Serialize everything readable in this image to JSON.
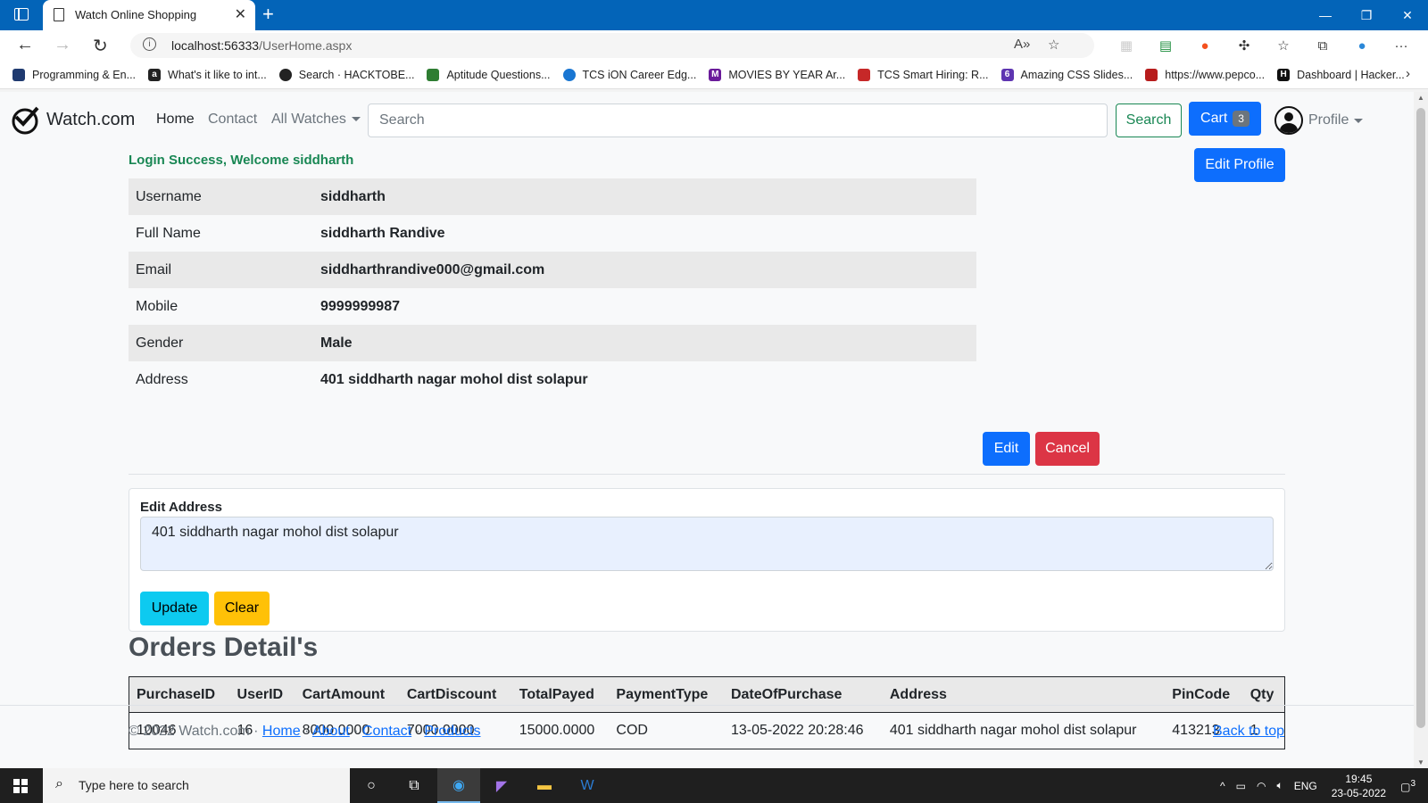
{
  "browser": {
    "tab_title": "Watch Online Shopping",
    "url_host": "localhost:56333",
    "url_path": "/UserHome.aspx"
  },
  "bookmarks": [
    {
      "label": "Programming & En...",
      "icon": "book-icon",
      "color": "#1f3a70"
    },
    {
      "label": "What's it like to int...",
      "icon": "amazon-icon",
      "color": "#222222"
    },
    {
      "label": "Search · HACKTOBE...",
      "icon": "github-icon",
      "color": "#222222"
    },
    {
      "label": "Aptitude Questions...",
      "icon": "leaf-icon",
      "color": "#2e7d32"
    },
    {
      "label": "TCS iON Career Edg...",
      "icon": "power-icon",
      "color": "#1976d2"
    },
    {
      "label": "MOVIES BY YEAR Ar...",
      "icon": "m-icon",
      "color": "#6a1b9a"
    },
    {
      "label": "TCS Smart Hiring: R...",
      "icon": "tcs-icon",
      "color": "#c62828"
    },
    {
      "label": "Amazing CSS Slides...",
      "icon": "six-icon",
      "color": "#5e35b1"
    },
    {
      "label": "https://www.pepco...",
      "icon": "cube-icon",
      "color": "#b71c1c"
    },
    {
      "label": "Dashboard | Hacker...",
      "icon": "hackerrank-icon",
      "color": "#111111"
    }
  ],
  "site": {
    "brand": "Watch.com",
    "nav": {
      "home": "Home",
      "contact": "Contact",
      "all_watches": "All Watches"
    },
    "search_placeholder": "Search",
    "search_button": "Search",
    "cart_label": "Cart",
    "cart_count": "3",
    "profile_label": "Profile"
  },
  "welcome": "Login Success, Welcome siddharth",
  "edit_profile_label": "Edit Profile",
  "details": [
    {
      "key": "Username",
      "value": "siddharth"
    },
    {
      "key": "Full Name",
      "value": "siddharth Randive"
    },
    {
      "key": "Email",
      "value": "siddharthrandive000@gmail.com"
    },
    {
      "key": "Mobile",
      "value": "9999999987"
    },
    {
      "key": "Gender",
      "value": "Male"
    },
    {
      "key": "Address",
      "value": "401 siddharth nagar mohol dist solapur"
    }
  ],
  "edit_label": "Edit",
  "cancel_label": "Cancel",
  "edit_address": {
    "label": "Edit Address",
    "value": "401 siddharth nagar mohol dist solapur",
    "update_label": "Update",
    "clear_label": "Clear"
  },
  "orders": {
    "title": "Orders Detail's",
    "columns": [
      "PurchaseID",
      "UserID",
      "CartAmount",
      "CartDiscount",
      "TotalPayed",
      "PaymentType",
      "DateOfPurchase",
      "Address",
      "PinCode",
      "Qty"
    ],
    "rows": [
      [
        "10046",
        "16",
        "8000.0000",
        "7000.0000",
        "15000.0000",
        "COD",
        "13-05-2022 20:28:46",
        "401 siddharth nagar mohol dist solapur",
        "413213",
        "1"
      ]
    ]
  },
  "footer": {
    "copyright": "© 2022 Watch.com ·",
    "links": [
      "Home",
      "About",
      "Contact",
      "Products"
    ],
    "back_to_top": "Back to top"
  },
  "taskbar": {
    "search_placeholder": "Type here to search",
    "lang": "ENG",
    "time": "19:45",
    "date": "23-05-2022",
    "notifications": "3"
  },
  "colors": {
    "browser_chrome": "#0364b8",
    "primary": "#0d6efd",
    "success": "#198754",
    "danger": "#dc3545",
    "info": "#0dcaf0",
    "warning": "#ffc107"
  }
}
